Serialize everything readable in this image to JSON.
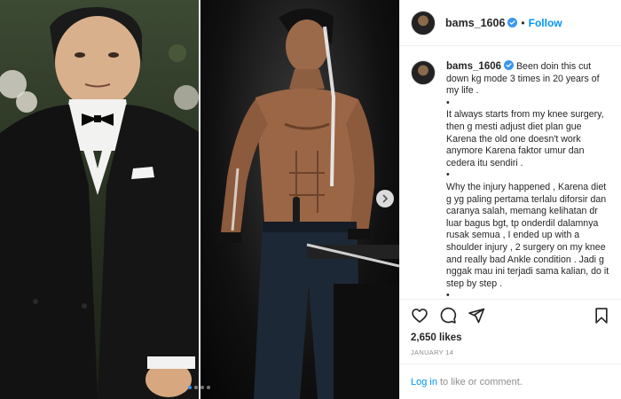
{
  "post": {
    "username": "bams_1606",
    "follow_label": "Follow",
    "separator": "•",
    "caption_lines": [
      "Been doin this cut down kg mode 3 times in 20 years of my life .",
      "•",
      "It always starts from my knee surgery, then g mesti adjust diet plan gue Karena the old one doesn't work anymore Karena faktor umur dan cedera itu sendiri .",
      "•",
      "Why the injury happened , Karena diet g yg paling pertama terlalu diforsir dan caranya salah, memang kelihatan dr luar bagus bgt, tp onderdil dalamnya rusak semua , I ended up with a shoulder injury , 2 surgery on my knee and really bad Ankle condition . Jadi g nggak mau ini terjadi sama kalian, do it step by step .",
      "•"
    ],
    "likes": "2,650 likes",
    "date": "JANUARY 14",
    "login_link": "Log in",
    "login_text": "to like or comment."
  },
  "carousel": {
    "slide_count": 4,
    "active_index": 0
  },
  "colors": {
    "accent": "#0095f6",
    "verified": "#3897f0",
    "text": "#262626",
    "muted": "#8e8e8e",
    "border": "#efefef"
  },
  "icons": [
    "verified-badge-icon",
    "heart-icon",
    "comment-icon",
    "share-icon",
    "bookmark-icon",
    "chevron-right-icon"
  ]
}
